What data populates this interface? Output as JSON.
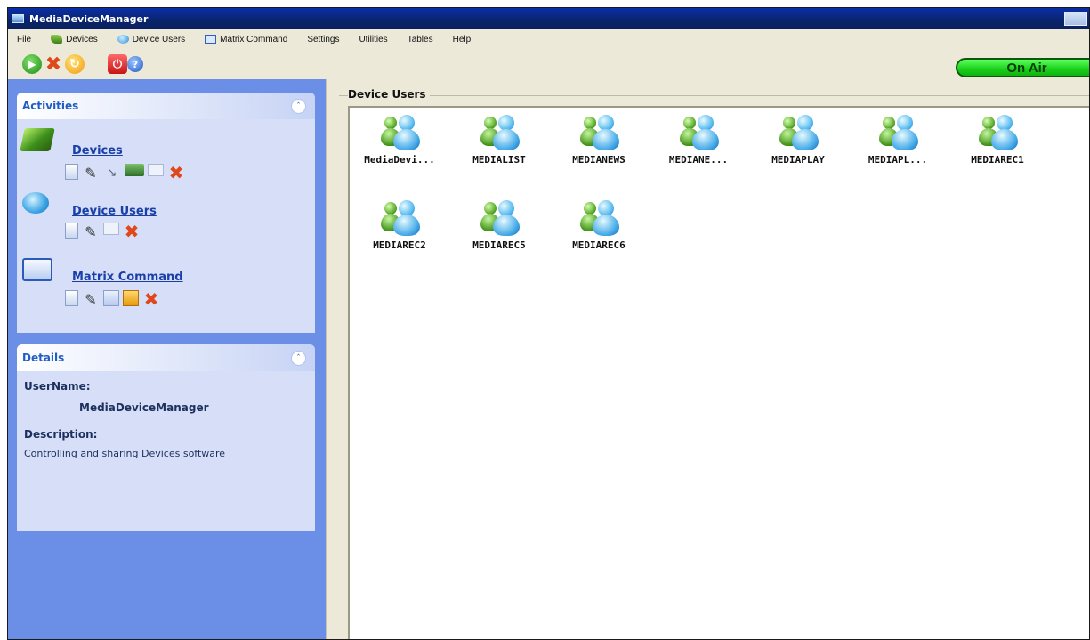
{
  "window": {
    "title": "MediaDeviceManager"
  },
  "menu": [
    {
      "label": "File",
      "icon": ""
    },
    {
      "label": "Devices",
      "icon": "devices-icon"
    },
    {
      "label": "Device Users",
      "icon": "device-users-icon"
    },
    {
      "label": "Matrix Command",
      "icon": "matrix-command-icon"
    },
    {
      "label": "Settings",
      "icon": ""
    },
    {
      "label": "Utilities",
      "icon": ""
    },
    {
      "label": "Tables",
      "icon": ""
    },
    {
      "label": "Help",
      "icon": ""
    }
  ],
  "toolbar": {
    "buttons": [
      "start-icon",
      "stop-icon",
      "refresh-icon",
      "power-icon",
      "help-icon"
    ],
    "status": "On Air",
    "status_color": "#19d019"
  },
  "activities": {
    "title": "Activities",
    "groups": [
      {
        "label": "Devices",
        "icon": "devices-icon",
        "tools": [
          "new-icon",
          "edit-icon",
          "download-icon",
          "folder-icon",
          "blank-icon",
          "delete-icon"
        ]
      },
      {
        "label": "Device Users",
        "icon": "device-users-icon",
        "tools": [
          "new-icon",
          "edit-icon",
          "blank-icon",
          "delete-icon"
        ]
      },
      {
        "label": "Matrix Command",
        "icon": "matrix-command-icon",
        "tools": [
          "new-icon",
          "edit-icon",
          "chart-icon",
          "calendar-icon",
          "delete-icon"
        ]
      }
    ]
  },
  "details": {
    "title": "Details",
    "username_label": "UserName:",
    "username_value": "MediaDeviceManager",
    "description_label": "Description:",
    "description_value": "Controlling and sharing Devices software"
  },
  "main": {
    "group_title": "Device Users",
    "users": [
      "MediaDevi...",
      "MEDIALIST",
      "MEDIANEWS",
      "MEDIANE...",
      "MEDIAPLAY",
      "MEDIAPL...",
      "MEDIAREC1",
      "MEDIAREC2",
      "MEDIAREC5",
      "MEDIAREC6"
    ]
  },
  "colors": {
    "left_panel": "#6b8fe6",
    "section_bg": "#d6dff7",
    "link": "#1a3fa8",
    "titlebar": "#0a246a"
  }
}
